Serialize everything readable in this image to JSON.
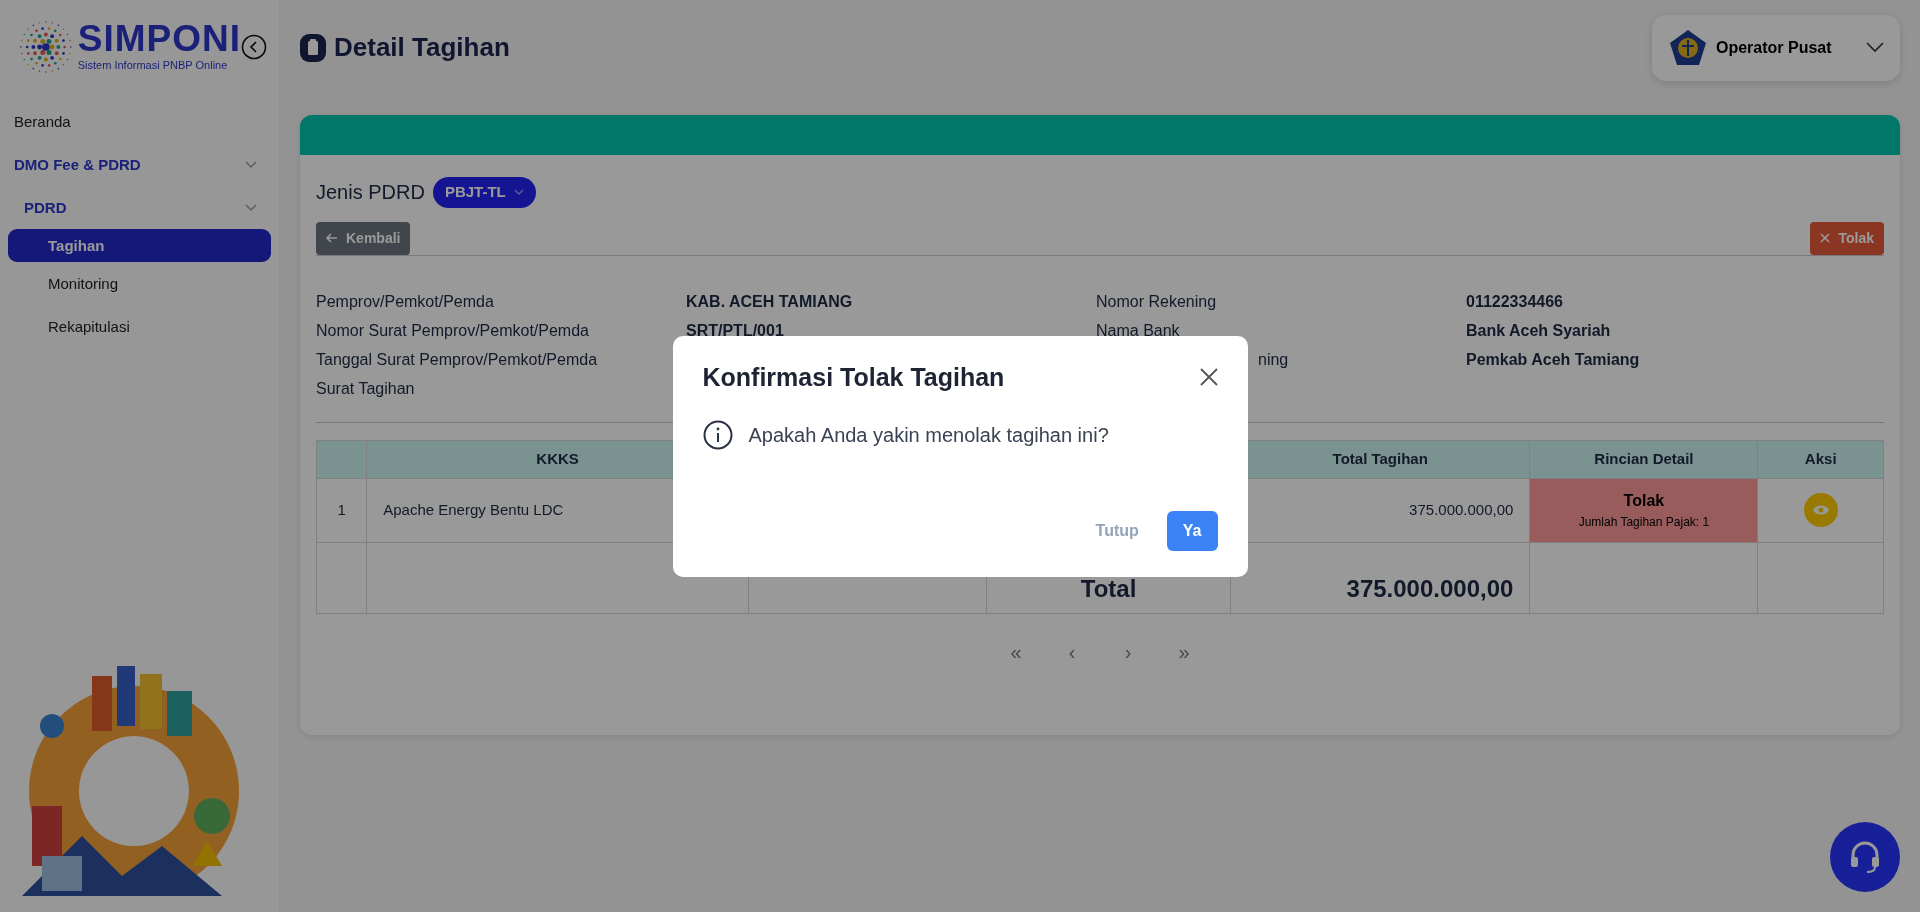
{
  "sidebar": {
    "logo_title": "SIMPONI",
    "logo_subtitle": "Sistem Informasi PNBP Online",
    "items": [
      {
        "label": "Beranda",
        "selected": false
      },
      {
        "label": "DMO Fee & PDRD",
        "selected": false,
        "expanded": true,
        "children": [
          {
            "label": "PDRD",
            "selected": false,
            "expanded": true,
            "children": [
              {
                "label": "Tagihan",
                "selected": true
              },
              {
                "label": "Monitoring",
                "selected": false
              },
              {
                "label": "Rekapitulasi",
                "selected": false
              }
            ]
          }
        ]
      }
    ]
  },
  "page": {
    "title": "Detail Tagihan"
  },
  "user": {
    "name": "Operator Pusat"
  },
  "card": {
    "jenis_label": "Jenis PDRD",
    "jenis_value": "PBJT-TL",
    "back_button": "Kembali",
    "reject_button": "Tolak"
  },
  "details_left": [
    {
      "label": "Pemprov/Pemkot/Pemda",
      "value": "KAB. ACEH TAMIANG"
    },
    {
      "label": "Nomor Surat Pemprov/Pemkot/Pemda",
      "value": "SRT/PTL/001"
    },
    {
      "label": "Tanggal Surat Pemprov/Pemkot/Pemda"
    },
    {
      "label": "Surat Tagihan"
    }
  ],
  "details_right": [
    {
      "label": "Nomor Rekening",
      "value": "01122334466"
    },
    {
      "label": "Nama Bank",
      "value": "Bank Aceh Syariah"
    },
    {
      "label": "ning",
      "value": "Pemkab Aceh Tamiang",
      "partly_covered": true
    }
  ],
  "table": {
    "columns": [
      {
        "kind": "index"
      },
      {
        "kind": "text",
        "label": "KKKS"
      },
      {
        "kind": "blank"
      },
      {
        "kind": "blank"
      },
      {
        "kind": "amount",
        "label": "Total Tagihan"
      },
      {
        "kind": "status",
        "label": "Rincian Detail"
      },
      {
        "kind": "action",
        "label": "Aksi"
      }
    ],
    "rows": [
      {
        "no": "1",
        "kkks": "Apache Energy Bentu LDC",
        "total": "375.000.000,00",
        "status": "Tolak",
        "status_note": "Jumlah Tagihan Pajak: 1"
      }
    ],
    "total_row": {
      "label": "Total",
      "amount": "375.000.000,00"
    }
  },
  "pagination": [
    "«",
    "‹",
    "›",
    "»"
  ],
  "modal": {
    "title": "Konfirmasi Tolak Tagihan",
    "message": "Apakah Anda yakin menolak tagihan ini?",
    "buttons": [
      {
        "label": "Tutup",
        "kind": "secondary"
      },
      {
        "label": "Ya",
        "kind": "primary"
      }
    ]
  }
}
